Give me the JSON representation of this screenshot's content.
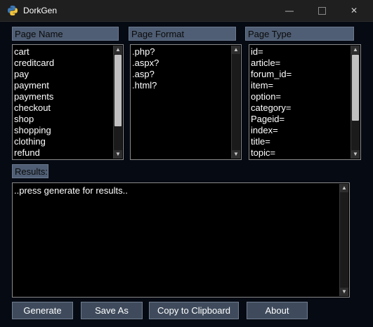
{
  "window": {
    "title": "DorkGen",
    "minimize_glyph": "—",
    "maximize_glyph": "",
    "close_glyph": "✕"
  },
  "page_name": {
    "header": "Page Name",
    "items": [
      "cart",
      "creditcard",
      "pay",
      "payment",
      "payments",
      "checkout",
      "shop",
      "shopping",
      "clothing",
      "refund"
    ]
  },
  "page_format": {
    "header": "Page Format",
    "items": [
      ".php?",
      ".aspx?",
      ".asp?",
      ".html?"
    ]
  },
  "page_type": {
    "header": "Page Type",
    "items": [
      "id=",
      "article=",
      "forum_id=",
      "item=",
      "option=",
      "category=",
      "Pageid=",
      "index=",
      "title=",
      "topic="
    ]
  },
  "results": {
    "label": "Results:",
    "text": "..press generate for results.."
  },
  "buttons": {
    "generate": "Generate",
    "save_as": "Save As",
    "copy": "Copy to Clipboard",
    "about": "About"
  },
  "scroll_icons": {
    "up": "▲",
    "down": "▼"
  },
  "colors": {
    "header_bg": "#4f5e74",
    "button_bg": "#3f4b5c",
    "list_bg": "#000000",
    "window_bg": "#060a12"
  }
}
